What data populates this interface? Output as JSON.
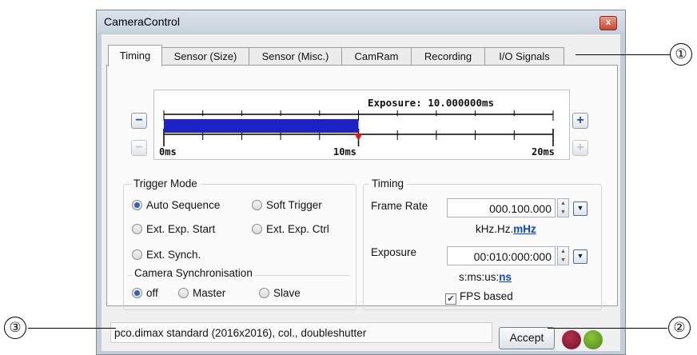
{
  "window": {
    "title": "CameraControl",
    "close": "x"
  },
  "tabs": [
    "Timing",
    "Sensor (Size)",
    "Sensor (Misc.)",
    "CamRam",
    "Recording",
    "I/O Signals"
  ],
  "ruler": {
    "exposure_label": "Exposure: 10.000000ms",
    "tick_labels": [
      "0ms",
      "10ms",
      "20ms"
    ],
    "exposure_ms": 10,
    "range_ms": [
      0,
      20
    ]
  },
  "trigger_mode": {
    "label": "Trigger Mode",
    "options": [
      "Auto Sequence",
      "Soft Trigger",
      "Ext. Exp. Start",
      "Ext. Exp. Ctrl",
      "Ext. Synch."
    ],
    "selected": "Auto Sequence"
  },
  "sync": {
    "label": "Camera Synchronisation",
    "options": [
      "off",
      "Master",
      "Slave"
    ],
    "selected": "off"
  },
  "timing": {
    "label": "Timing",
    "frame_rate_label": "Frame Rate",
    "frame_rate_value": "000.100.000",
    "frame_rate_units_prefix": "kHz.Hz.",
    "frame_rate_units_active": "mHz",
    "exposure_label": "Exposure",
    "exposure_value": "00:010:000:000",
    "exposure_units_prefix": "s:ms:us:",
    "exposure_units_active": "ns",
    "fps_based_label": "FPS based",
    "fps_based_checked": true
  },
  "status": "pco.dimax standard (2016x2016), col., doubleshutter",
  "accept_label": "Accept",
  "leds": {
    "left_color": "#7a0f2a",
    "right_color": "#4e8a12"
  },
  "callouts": [
    "①",
    "②",
    "③"
  ],
  "colors": {
    "exposure_bar": "#1c21c8",
    "marker": "#e81010"
  }
}
